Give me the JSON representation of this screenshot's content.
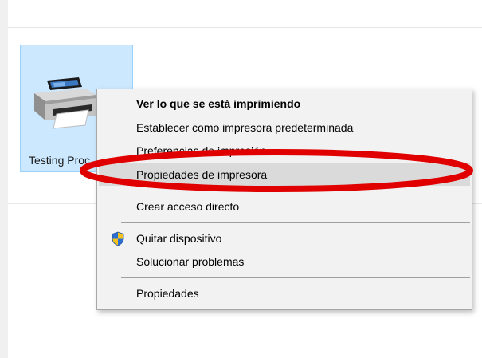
{
  "device": {
    "label": "Testing Proc",
    "icon": "printer-icon"
  },
  "context_menu": {
    "items": [
      {
        "label": "Ver lo que se está imprimiendo",
        "bold": true
      },
      {
        "label": "Establecer como impresora predeterminada"
      },
      {
        "label": "Preferencias de impresión"
      },
      {
        "label": "Propiedades de impresora",
        "highlighted": true
      },
      {
        "label": "Crear acceso directo"
      },
      {
        "label": "Quitar dispositivo",
        "icon": "shield-icon"
      },
      {
        "label": "Solucionar problemas"
      },
      {
        "label": "Propiedades"
      }
    ]
  },
  "colors": {
    "selection": "#cce8ff",
    "menu_background": "#f2f2f2",
    "menu_hover": "#dadada",
    "annotation": "#e00000"
  }
}
